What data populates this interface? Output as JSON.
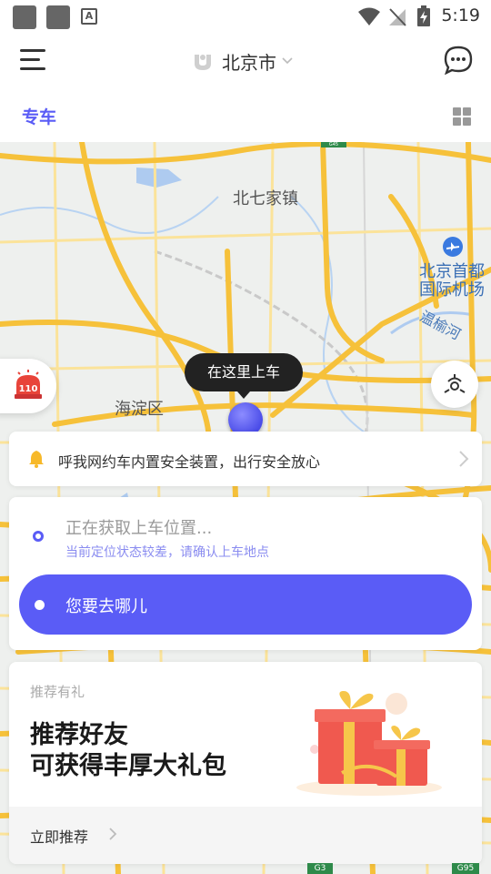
{
  "status_bar": {
    "time": "5:19",
    "notification_icon_text": "A"
  },
  "header": {
    "city": "北京市"
  },
  "tabs": {
    "active": "专车"
  },
  "map": {
    "labels": {
      "town": "北七家镇",
      "airport_line1": "北京首都",
      "airport_line2": "国际机场",
      "river": "温榆河",
      "district": "海淀区"
    },
    "sos_label": "110",
    "pickup_tooltip": "在这里上车",
    "road_shields": [
      "G45",
      "G3",
      "G95"
    ]
  },
  "notice": {
    "text": "呼我网约车内置安全装置，出行安全放心"
  },
  "route": {
    "origin_status": "正在获取上车位置...",
    "origin_hint": "当前定位状态较差，请确认上车地点",
    "destination_placeholder": "您要去哪儿"
  },
  "promo": {
    "tag": "推荐有礼",
    "title_line1": "推荐好友",
    "title_line2": "可获得丰厚大礼包",
    "cta": "立即推荐"
  },
  "colors": {
    "accent": "#5a5cf6",
    "road": "#f6c13a",
    "map_bg": "#eef0ee"
  }
}
